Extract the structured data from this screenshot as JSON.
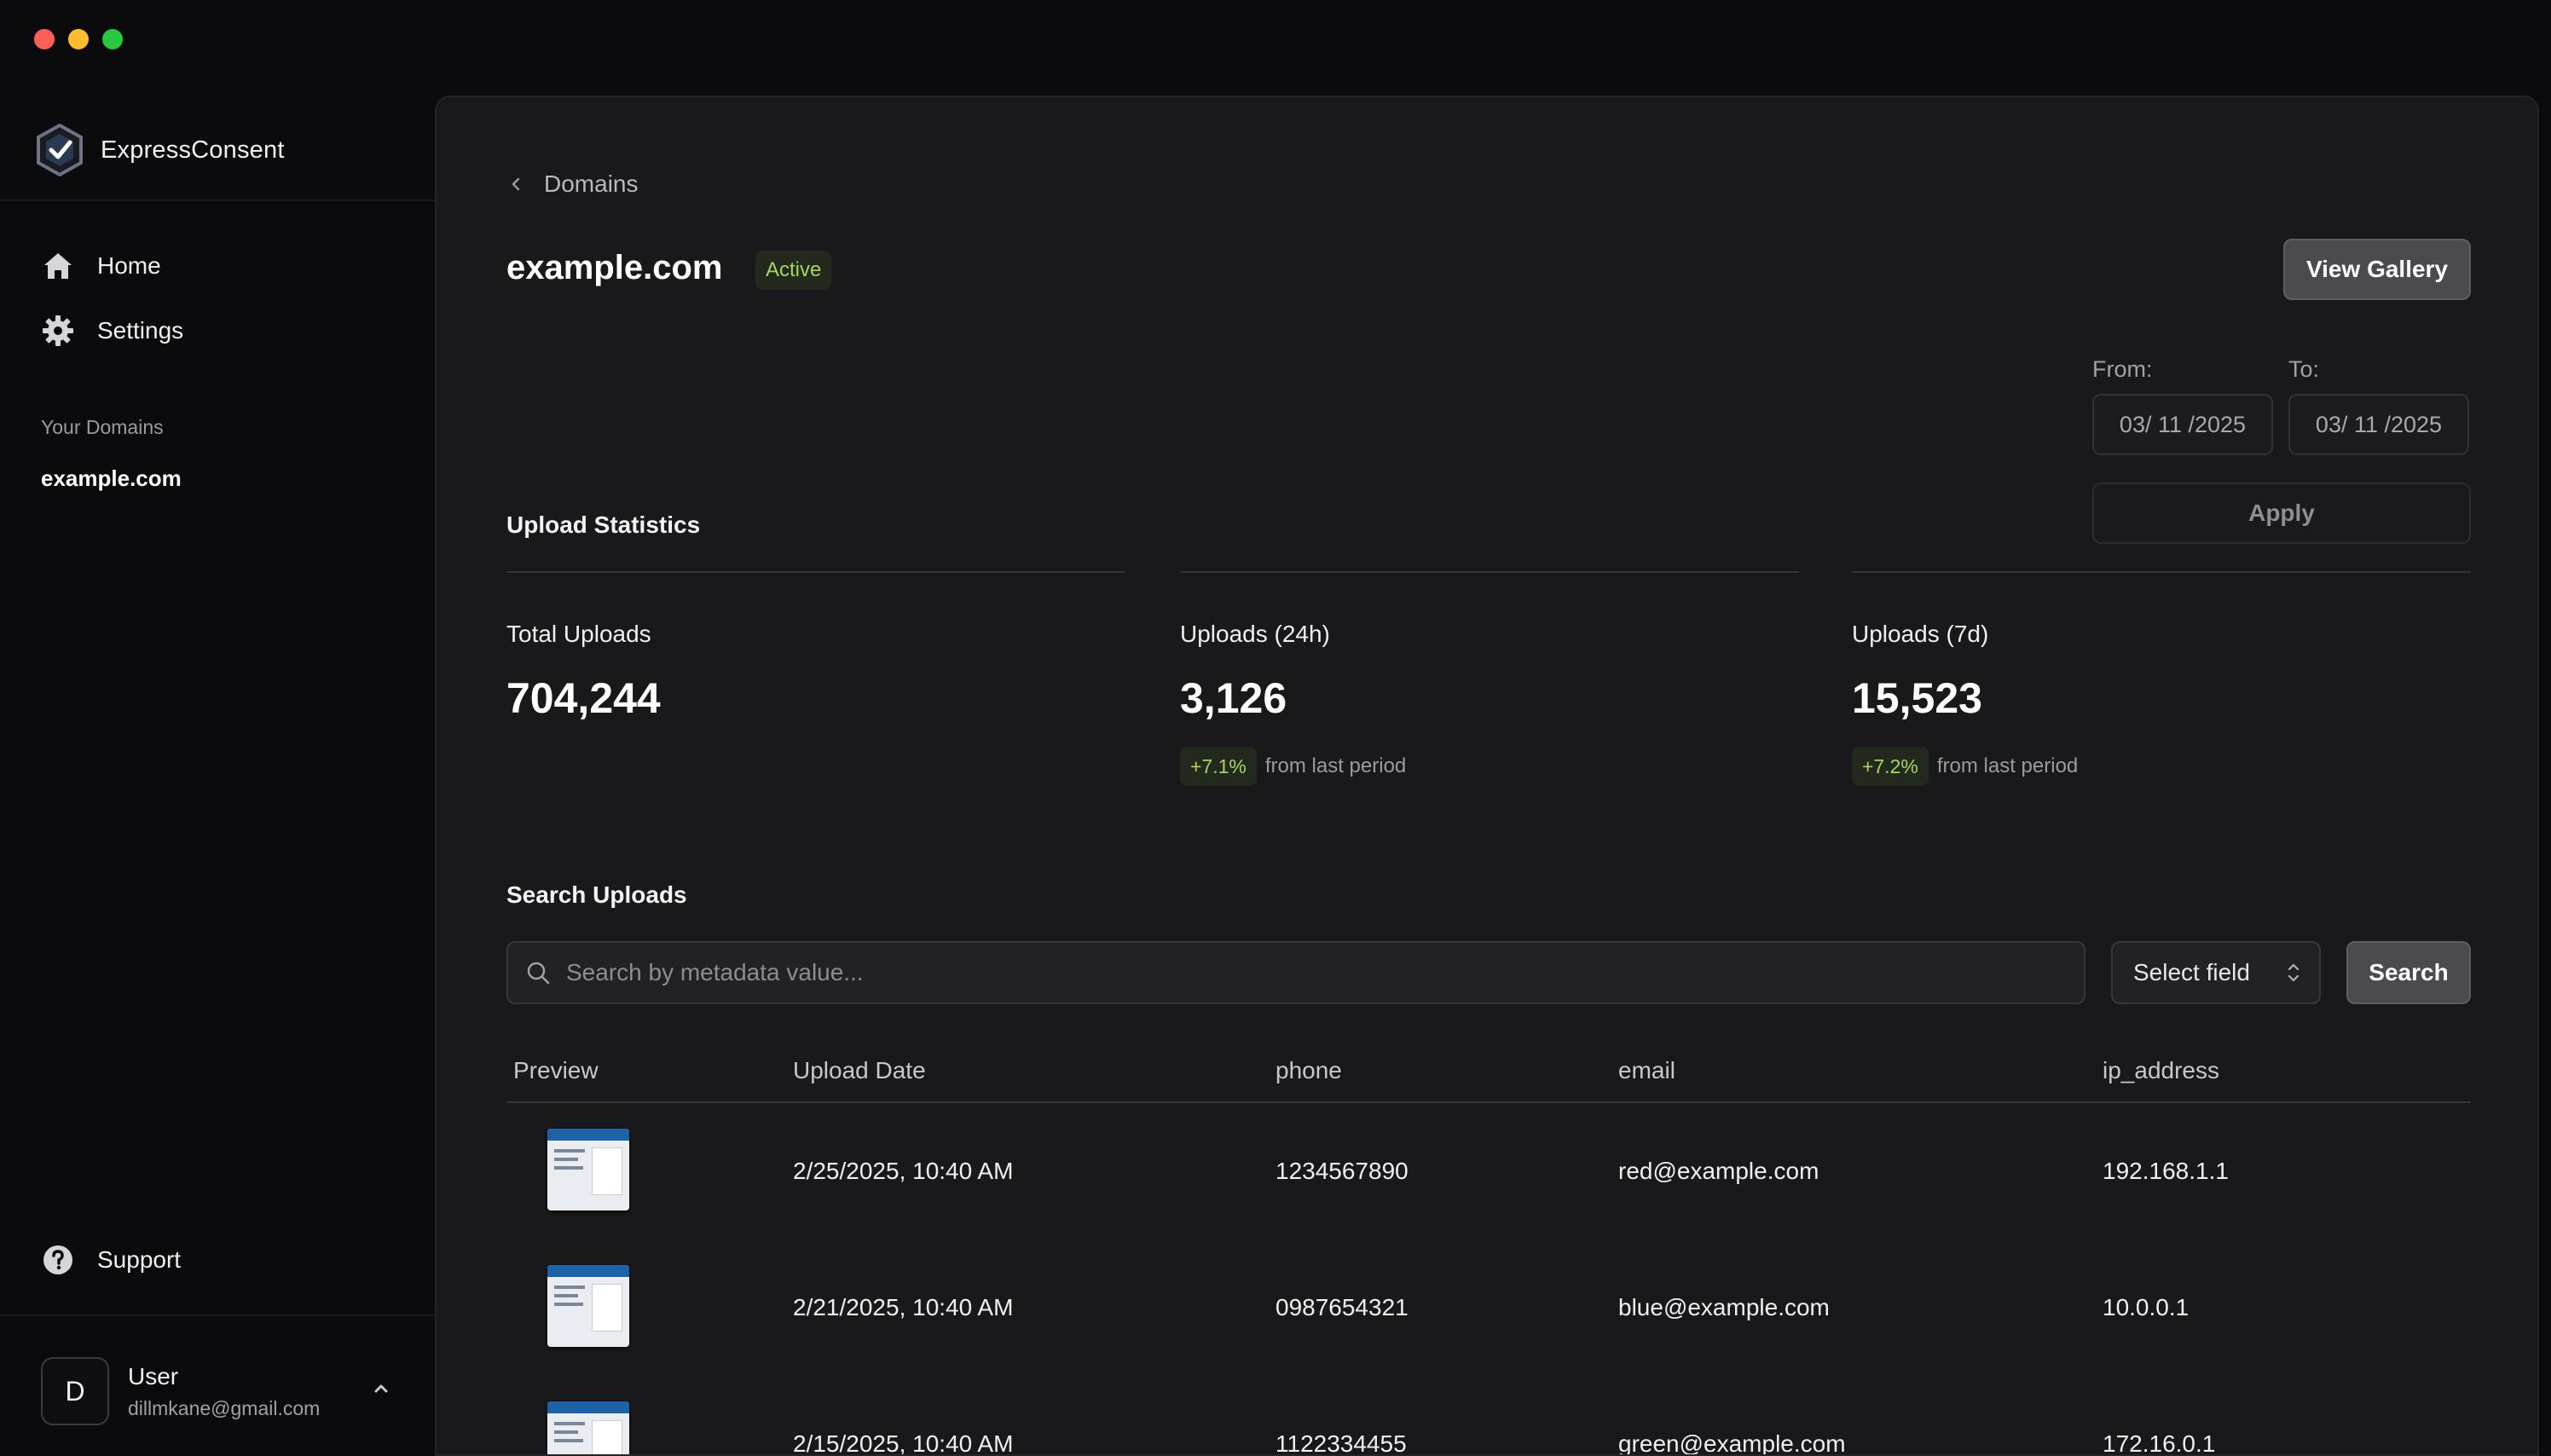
{
  "app": {
    "name": "ExpressConsent"
  },
  "sidebar": {
    "nav": [
      {
        "label": "Home",
        "icon": "home-icon"
      },
      {
        "label": "Settings",
        "icon": "gear-icon"
      }
    ],
    "domains_section_label": "Your Domains",
    "domains": [
      "example.com"
    ],
    "support_label": "Support",
    "user": {
      "initial": "D",
      "name": "User",
      "email": "dillmkane@gmail.com"
    }
  },
  "header": {
    "breadcrumb": "Domains",
    "title": "example.com",
    "status": "Active",
    "view_gallery_label": "View Gallery"
  },
  "date_filter": {
    "from_label": "From:",
    "to_label": "To:",
    "from_value": "03/ 11 /2025",
    "to_value": "03/ 11 /2025",
    "apply_label": "Apply"
  },
  "stats": {
    "title": "Upload Statistics",
    "items": [
      {
        "label": "Total Uploads",
        "value": "704,244",
        "change": "",
        "change_text": ""
      },
      {
        "label": "Uploads (24h)",
        "value": "3,126",
        "change": "+7.1%",
        "change_text": "from last period"
      },
      {
        "label": "Uploads (7d)",
        "value": "15,523",
        "change": "+7.2%",
        "change_text": "from last period"
      }
    ]
  },
  "search": {
    "title": "Search Uploads",
    "placeholder": "Search by metadata value...",
    "select_label": "Select field",
    "button_label": "Search"
  },
  "table": {
    "columns": [
      "Preview",
      "Upload Date",
      "phone",
      "email",
      "ip_address"
    ],
    "rows": [
      {
        "date": "2/25/2025, 10:40 AM",
        "phone": "1234567890",
        "email": "red@example.com",
        "ip": "192.168.1.1"
      },
      {
        "date": "2/21/2025, 10:40 AM",
        "phone": "0987654321",
        "email": "blue@example.com",
        "ip": "10.0.0.1"
      },
      {
        "date": "2/15/2025, 10:40 AM",
        "phone": "1122334455",
        "email": "green@example.com",
        "ip": "172.16.0.1"
      }
    ]
  },
  "colors": {
    "accent_green": "#a6d65b",
    "badge_bg": "#23291d",
    "panel_bg": "#19191b"
  }
}
